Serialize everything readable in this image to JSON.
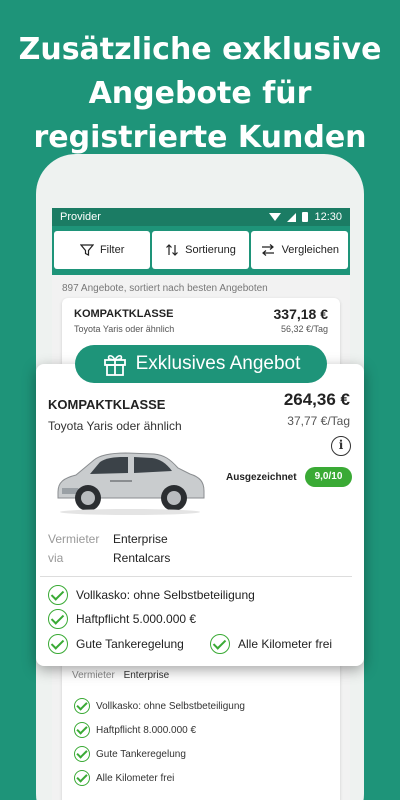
{
  "headline": [
    "Zusätzliche exklusive",
    "Angebote für",
    "registrierte Kunden"
  ],
  "statusbar": {
    "provider": "Provider",
    "time": "12:30"
  },
  "toolbar": {
    "filter": "Filter",
    "sort": "Sortierung",
    "compare": "Vergleichen"
  },
  "results": {
    "count_text": "897 Angebote, sortiert nach besten Angeboten"
  },
  "offer1": {
    "class": "KOMPAKTKLASSE",
    "model": "Toyota Yaris oder ähnlich",
    "price": "337,18 €",
    "per_day": "56,32 €/Tag"
  },
  "exclusive": {
    "badge": "Exklusives Angebot",
    "class": "KOMPAKTKLASSE",
    "model": "Toyota Yaris oder ähnlich",
    "price": "264,36 €",
    "per_day": "37,77 €/Tag",
    "award_label": "Ausgezeichnet",
    "score": "9,0/10",
    "vermieter_label": "Vermieter",
    "vermieter": "Enterprise",
    "via_label": "via",
    "via": "Rentalcars",
    "features": [
      "Vollkasko: ohne Selbstbeteiligung",
      "Haftpflicht 5.000.000 €",
      "Gute Tankeregelung",
      "Alle Kilometer frei"
    ]
  },
  "offer2": {
    "vermieter_label": "Vermieter",
    "vermieter": "Enterprise",
    "features": [
      "Vollkasko: ohne Selbstbeteiligung",
      "Haftpflicht 8.000.000 €",
      "Gute Tankeregelung",
      "Alle Kilometer frei"
    ]
  },
  "colors": {
    "brand": "#1e9479",
    "accent_green": "#3aaa35"
  }
}
